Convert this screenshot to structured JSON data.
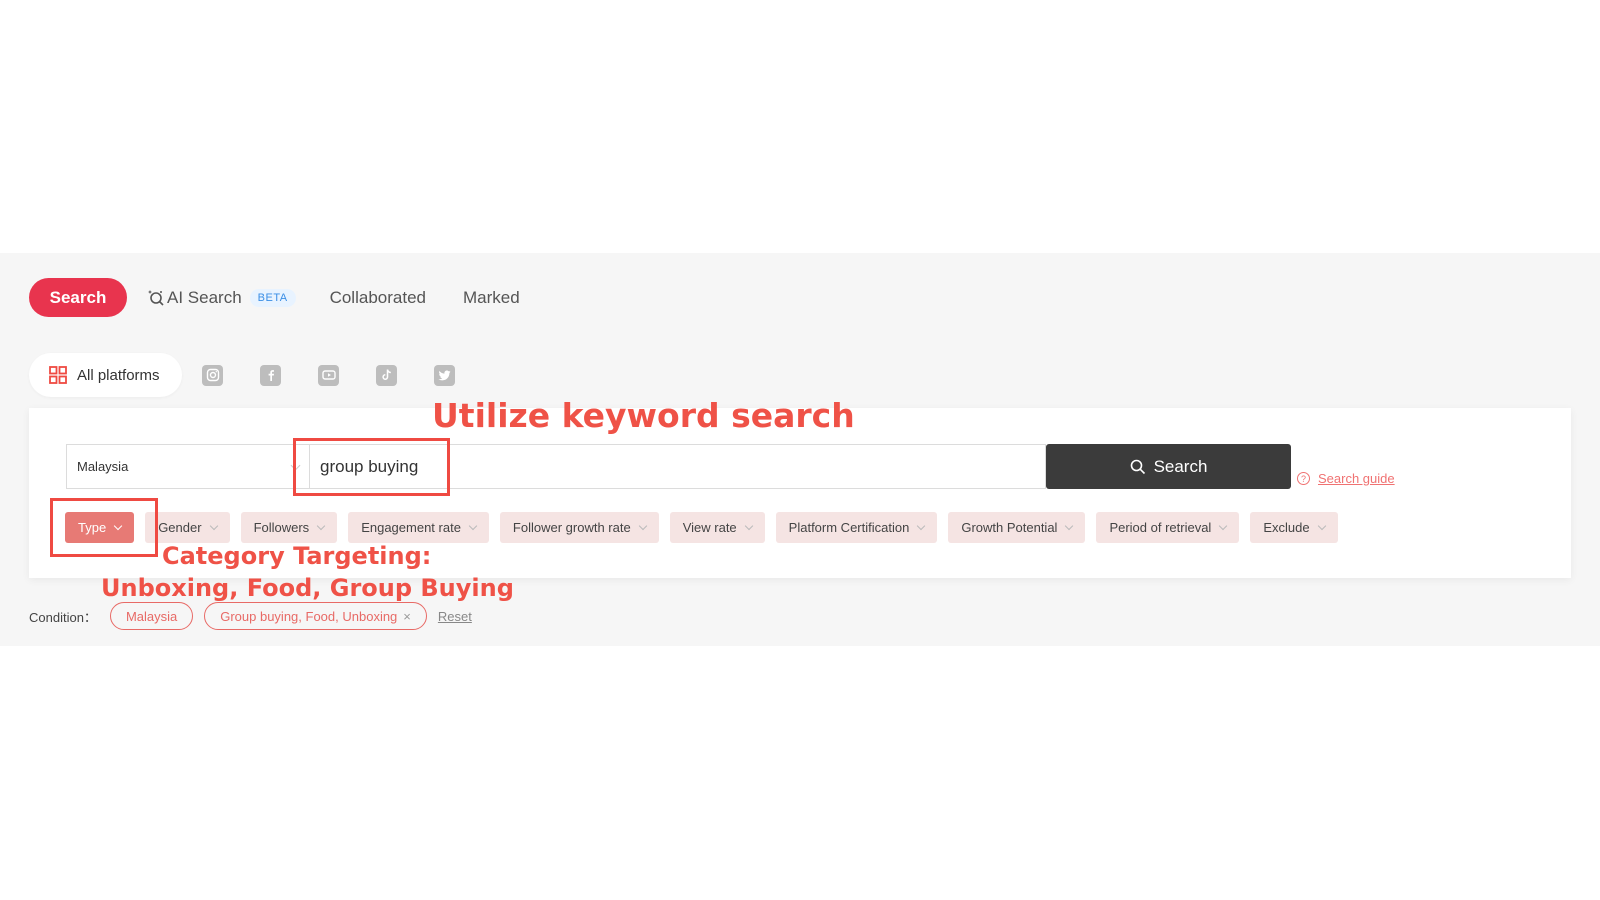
{
  "tabs": {
    "search": "Search",
    "ai_search": "AI Search",
    "beta_badge": "BETA",
    "collaborated": "Collaborated",
    "marked": "Marked"
  },
  "platforms": {
    "all_label": "All platforms",
    "icons": [
      "instagram-icon",
      "facebook-icon",
      "youtube-icon",
      "tiktok-icon",
      "twitter-icon"
    ]
  },
  "search": {
    "country": "Malaysia",
    "keyword": "group buying",
    "button_label": "Search",
    "guide_label": "Search guide"
  },
  "filters": [
    {
      "label": "Type",
      "active": true
    },
    {
      "label": "Gender",
      "active": false
    },
    {
      "label": "Followers",
      "active": false
    },
    {
      "label": "Engagement rate",
      "active": false
    },
    {
      "label": "Follower growth rate",
      "active": false
    },
    {
      "label": "View rate",
      "active": false
    },
    {
      "label": "Platform Certification",
      "active": false
    },
    {
      "label": "Growth Potential",
      "active": false
    },
    {
      "label": "Period of retrieval",
      "active": false
    },
    {
      "label": "Exclude",
      "active": false
    }
  ],
  "conditions": {
    "label": "Condition：",
    "tags": [
      "Malaysia",
      "Group buying, Food, Unboxing"
    ],
    "remove_symbol": "×",
    "reset_label": "Reset"
  },
  "annotations": {
    "keyword": "Utilize keyword search",
    "category_line1": "Category Targeting:",
    "category_line2": "Unboxing, Food, Group Buying"
  },
  "colors": {
    "brand_red": "#e8344e",
    "annotation_red": "#ef4a42",
    "search_button": "#3b3b3b",
    "filter_bg": "#f5e4e3",
    "filter_active": "#e77a75"
  }
}
